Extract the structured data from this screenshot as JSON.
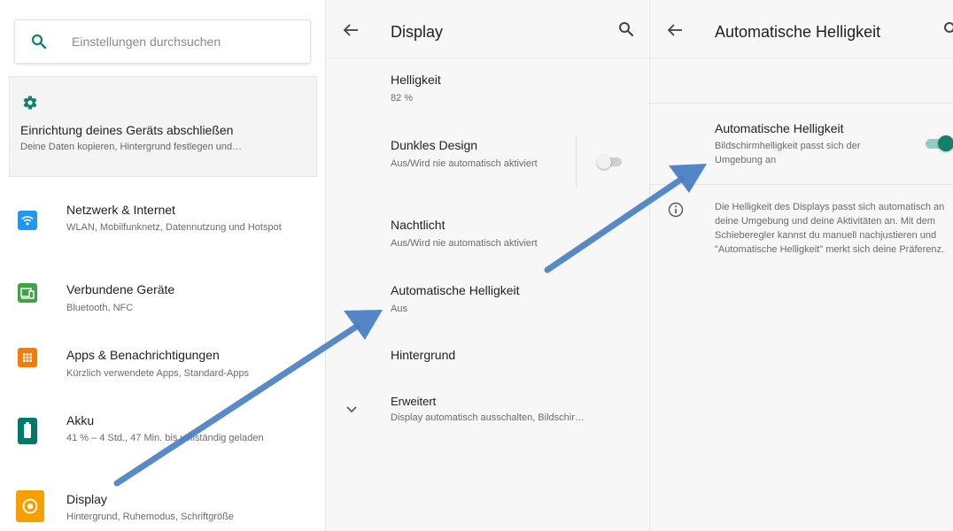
{
  "colors": {
    "accent": "#12806b",
    "arrow": "#4a80c4"
  },
  "panel_settings": {
    "search_placeholder": "Einstellungen durchsuchen",
    "setup_card": {
      "title": "Einrichtung deines Geräts abschließen",
      "subtitle": "Deine Daten kopieren, Hintergrund festlegen und…"
    },
    "items": [
      {
        "title": "Netzwerk & Internet",
        "subtitle": "WLAN, Mobilfunknetz, Datennutzung und Hotspot",
        "icon": "wifi-icon",
        "color": "#2196f3"
      },
      {
        "title": "Verbundene Geräte",
        "subtitle": "Bluetooth, NFC",
        "icon": "devices-icon",
        "color": "#43a047"
      },
      {
        "title": "Apps & Benachrichtigungen",
        "subtitle": "Kürzlich verwendete Apps, Standard-Apps",
        "icon": "apps-icon",
        "color": "#f57c00"
      },
      {
        "title": "Akku",
        "subtitle": "41 % – 4 Std., 47 Min. bis vollständig geladen",
        "icon": "battery-icon",
        "color": "#00796b"
      },
      {
        "title": "Display",
        "subtitle": "Hintergrund, Ruhemodus, Schriftgröße",
        "icon": "display-icon",
        "color": "#f59f00"
      }
    ]
  },
  "panel_display": {
    "title": "Display",
    "items": [
      {
        "title": "Helligkeit",
        "subtitle": "82 %"
      },
      {
        "title": "Dunkles Design",
        "subtitle": "Aus/Wird nie automatisch aktiviert"
      },
      {
        "title": "Nachtlicht",
        "subtitle": "Aus/Wird nie automatisch aktiviert"
      },
      {
        "title": "Automatische Helligkeit",
        "subtitle": "Aus"
      },
      {
        "title": "Hintergrund",
        "subtitle": ""
      },
      {
        "title": "Erweitert",
        "subtitle": "Display automatisch ausschalten, Bildschir…"
      }
    ],
    "dark_theme_toggle": "off"
  },
  "panel_adaptive": {
    "title": "Automatische Helligkeit",
    "setting": {
      "title": "Automatische Helligkeit",
      "subtitle": "Bildschirmhelligkeit passt sich der Umgebung an",
      "toggle": "on"
    },
    "info": "Die Helligkeit des Displays passt sich automatisch an deine Umgebung und deine Aktivitäten an. Mit dem Schieberegler kannst du manuell nachjustieren und \"Automatische Helligkeit\" merkt sich deine Präferenz."
  }
}
